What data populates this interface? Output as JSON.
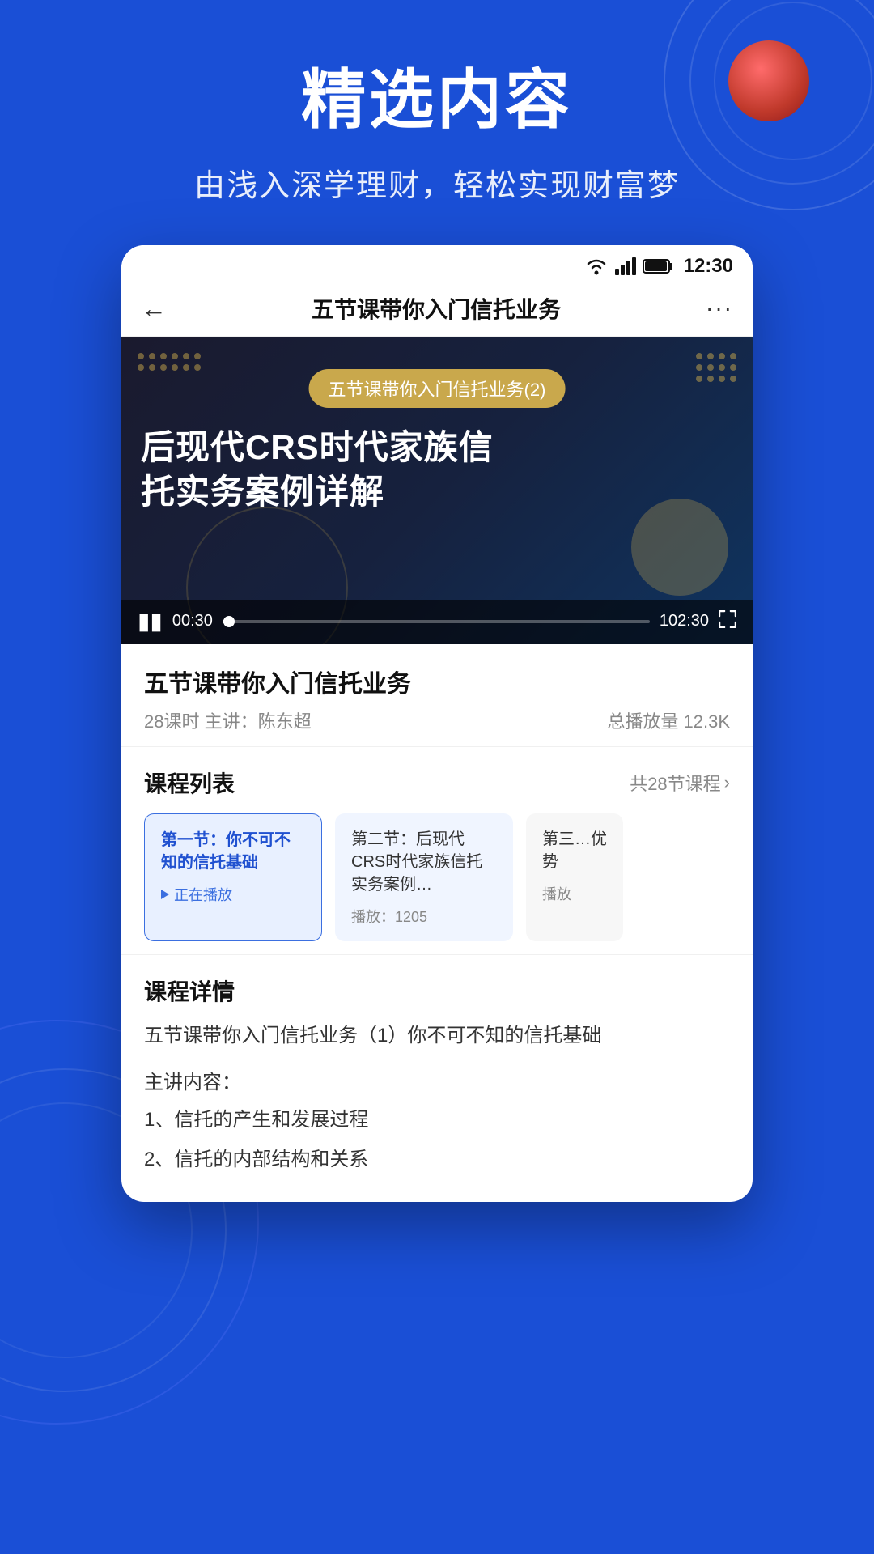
{
  "background": {
    "color": "#1a4fd6"
  },
  "header": {
    "title": "精选内容",
    "subtitle": "由浅入深学理财，轻松实现财富梦"
  },
  "phone": {
    "statusBar": {
      "time": "12:30"
    },
    "navBar": {
      "back": "←",
      "title": "五节课带你入门信托业务",
      "more": "···"
    },
    "videoPlayer": {
      "tag": "五节课带你入门信托业务(2)",
      "titleLine1": "后现代CRS时代家族信",
      "titleLine2": "托实务案例详解",
      "timeCurrentLabel": "00:30",
      "timeTotalLabel": "102:30"
    },
    "courseInfo": {
      "title": "五节课带你入门信托业务",
      "metaLeft": "28课时  主讲：陈东超",
      "metaRight": "总播放量 12.3K"
    },
    "courseList": {
      "sectionTitle": "课程列表",
      "sectionLink": "共28节课程",
      "episodes": [
        {
          "id": 1,
          "title": "第一节：你不可不知的信托基础",
          "status": "playing",
          "playingLabel": "正在播放",
          "active": true
        },
        {
          "id": 2,
          "title": "第二节：后现代CRS时代家族信托实务案例…",
          "status": "inactive",
          "playCount": "播放：1205",
          "active": false
        },
        {
          "id": 3,
          "title": "第三…优势",
          "status": "inactive",
          "playCountLabel": "播放",
          "active": false
        }
      ]
    },
    "courseDetail": {
      "sectionTitle": "课程详情",
      "description": "五节课带你入门信托业务（1）你不可不知的信托基础",
      "subtitleLabel": "主讲内容：",
      "items": [
        "1、信托的产生和发展过程",
        "2、信托的内部结构和关系"
      ]
    }
  }
}
